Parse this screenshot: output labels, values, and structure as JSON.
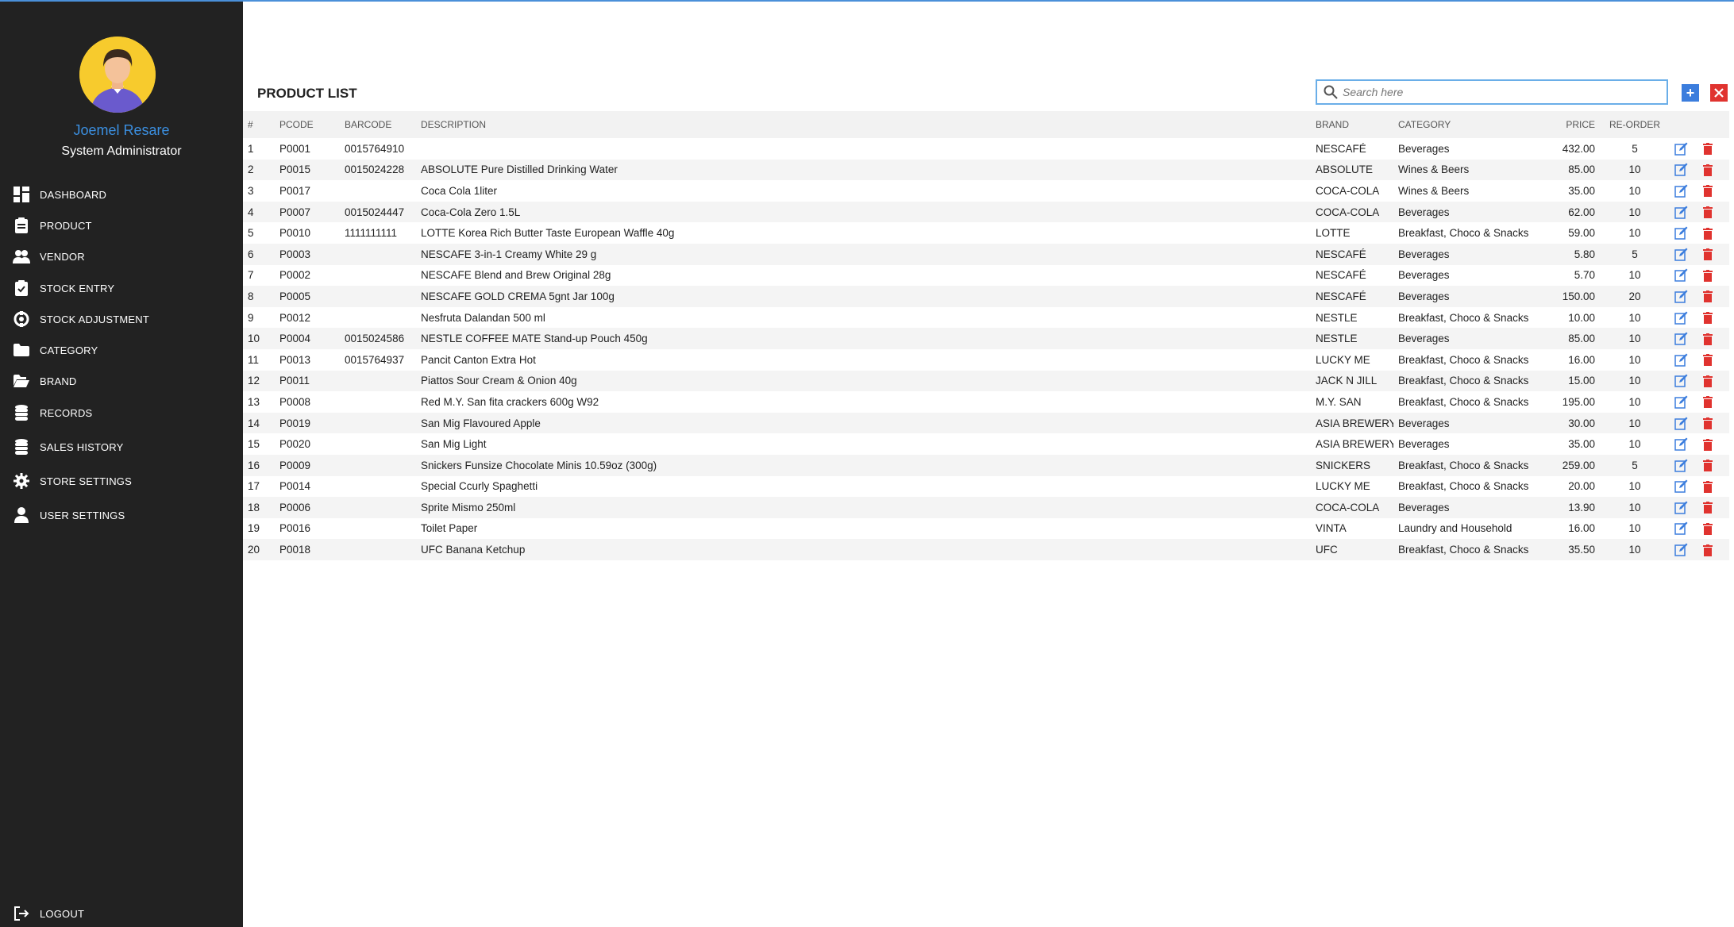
{
  "user": {
    "name": "Joemel Resare",
    "role": "System Administrator"
  },
  "nav": [
    {
      "label": "DASHBOARD",
      "icon": "dashboard-icon"
    },
    {
      "label": "PRODUCT",
      "icon": "product-icon"
    },
    {
      "label": "VENDOR",
      "icon": "vendor-icon"
    },
    {
      "label": "STOCK ENTRY",
      "icon": "stock-entry-icon"
    },
    {
      "label": "STOCK ADJUSTMENT",
      "icon": "stock-adjustment-icon"
    },
    {
      "label": "CATEGORY",
      "icon": "folder-icon"
    },
    {
      "label": "BRAND",
      "icon": "folder-open-icon"
    },
    {
      "label": "RECORDS",
      "icon": "database-icon"
    },
    {
      "label": "SALES HISTORY",
      "icon": "database-icon"
    },
    {
      "label": "STORE SETTINGS",
      "icon": "gear-icon"
    },
    {
      "label": "USER SETTINGS",
      "icon": "user-icon"
    }
  ],
  "logout_label": "LOGOUT",
  "page_title": "PRODUCT LIST",
  "search": {
    "placeholder": "Search here",
    "value": ""
  },
  "colors": {
    "sidebar": "#222222",
    "accent": "#3b7ddd",
    "danger": "#e0332f",
    "username": "#3b8fe0"
  },
  "table": {
    "headers": [
      "#",
      "PCODE",
      "BARCODE",
      "DESCRIPTION",
      "BRAND",
      "CATEGORY",
      "PRICE",
      "RE-ORDER"
    ],
    "rows": [
      [
        "1",
        "P0001",
        "0015764910",
        "",
        "NESCAFÉ",
        "Beverages",
        "432.00",
        "5"
      ],
      [
        "2",
        "P0015",
        "0015024228",
        "ABSOLUTE Pure Distilled Drinking Water",
        "ABSOLUTE",
        "Wines & Beers",
        "85.00",
        "10"
      ],
      [
        "3",
        "P0017",
        "",
        "Coca Cola 1liter",
        "COCA-COLA",
        "Wines & Beers",
        "35.00",
        "10"
      ],
      [
        "4",
        "P0007",
        "0015024447",
        "Coca-Cola Zero 1.5L",
        "COCA-COLA",
        "Beverages",
        "62.00",
        "10"
      ],
      [
        "5",
        "P0010",
        "1111111111",
        "LOTTE Korea Rich Butter Taste European Waffle 40g",
        "LOTTE",
        "Breakfast, Choco & Snacks",
        "59.00",
        "10"
      ],
      [
        "6",
        "P0003",
        "",
        "NESCAFE 3-in-1 Creamy White 29 g",
        "NESCAFÉ",
        "Beverages",
        "5.80",
        "5"
      ],
      [
        "7",
        "P0002",
        "",
        "NESCAFE Blend and Brew Original 28g",
        "NESCAFÉ",
        "Beverages",
        "5.70",
        "10"
      ],
      [
        "8",
        "P0005",
        "",
        "NESCAFE GOLD CREMA 5gnt Jar 100g",
        "NESCAFÉ",
        "Beverages",
        "150.00",
        "20"
      ],
      [
        "9",
        "P0012",
        "",
        "Nesfruta Dalandan 500 ml",
        "NESTLE",
        "Breakfast, Choco & Snacks",
        "10.00",
        "10"
      ],
      [
        "10",
        "P0004",
        "0015024586",
        "NESTLE COFFEE MATE Stand-up Pouch 450g",
        "NESTLE",
        "Beverages",
        "85.00",
        "10"
      ],
      [
        "11",
        "P0013",
        "0015764937",
        "Pancit Canton Extra Hot",
        "LUCKY ME",
        "Breakfast, Choco & Snacks",
        "16.00",
        "10"
      ],
      [
        "12",
        "P0011",
        "",
        "Piattos Sour Cream & Onion 40g",
        "JACK N JILL",
        "Breakfast, Choco & Snacks",
        "15.00",
        "10"
      ],
      [
        "13",
        "P0008",
        "",
        "Red M.Y. San fita crackers 600g W92",
        "M.Y. SAN",
        "Breakfast, Choco & Snacks",
        "195.00",
        "10"
      ],
      [
        "14",
        "P0019",
        "",
        "San Mig Flavoured Apple",
        "ASIA BREWERY",
        "Beverages",
        "30.00",
        "10"
      ],
      [
        "15",
        "P0020",
        "",
        "San Mig Light",
        "ASIA BREWERY",
        "Beverages",
        "35.00",
        "10"
      ],
      [
        "16",
        "P0009",
        "",
        "Snickers Funsize Chocolate Minis 10.59oz (300g)",
        "SNICKERS",
        "Breakfast, Choco & Snacks",
        "259.00",
        "5"
      ],
      [
        "17",
        "P0014",
        "",
        "Special Ccurly Spaghetti",
        "LUCKY ME",
        "Breakfast, Choco & Snacks",
        "20.00",
        "10"
      ],
      [
        "18",
        "P0006",
        "",
        "Sprite Mismo 250ml",
        "COCA-COLA",
        "Beverages",
        "13.90",
        "10"
      ],
      [
        "19",
        "P0016",
        "",
        "Toilet Paper",
        "VINTA",
        "Laundry and Household",
        "16.00",
        "10"
      ],
      [
        "20",
        "P0018",
        "",
        "UFC Banana Ketchup",
        "UFC",
        "Breakfast, Choco & Snacks",
        "35.50",
        "10"
      ]
    ]
  }
}
